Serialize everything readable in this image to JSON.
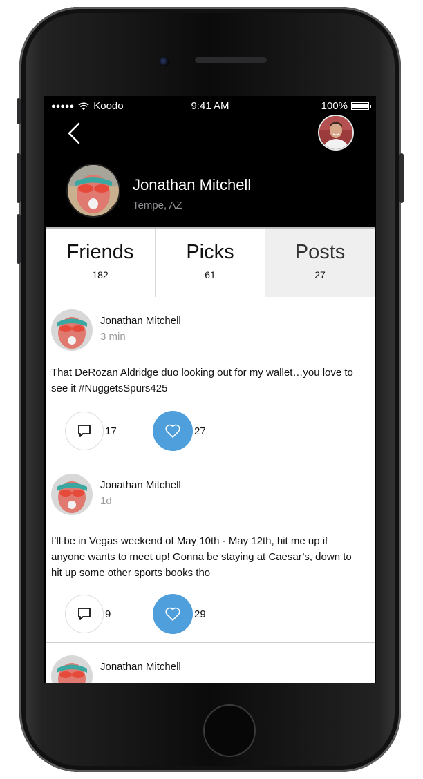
{
  "status_bar": {
    "signal": "●●●●●",
    "carrier": "Koodo",
    "time": "9:41 AM",
    "battery": "100%",
    "battery_level": 1.0
  },
  "header": {
    "name": "Jonathan Mitchell",
    "location": "Tempe, AZ"
  },
  "stats": [
    {
      "label": "Friends",
      "value": "182"
    },
    {
      "label": "Picks",
      "value": "61"
    },
    {
      "label": "Posts",
      "value": "27",
      "selected": true
    }
  ],
  "posts": [
    {
      "author": "Jonathan Mitchell",
      "time": "3 min",
      "text": "That DeRozan Aldridge duo looking out for my wallet…you love to see it #NuggetsSpurs425",
      "comments": "17",
      "likes": "27"
    },
    {
      "author": "Jonathan Mitchell",
      "time": "1d",
      "text": "I’ll be in Vegas weekend of May 10th - May 12th, hit me up if anyone wants to meet up! Gonna be staying at Caesar’s, down to hit up some other sports books tho",
      "comments": "9",
      "likes": "29"
    },
    {
      "author": "Jonathan Mitchell",
      "time": "",
      "text": "",
      "comments": "",
      "likes": ""
    }
  ],
  "colors": {
    "accent": "#4f9fdc",
    "header_bg": "#000000",
    "selected_tab": "#efefef"
  },
  "icons": [
    "back-chevron-icon",
    "comment-icon",
    "heart-icon",
    "wifi-icon",
    "battery-icon"
  ]
}
